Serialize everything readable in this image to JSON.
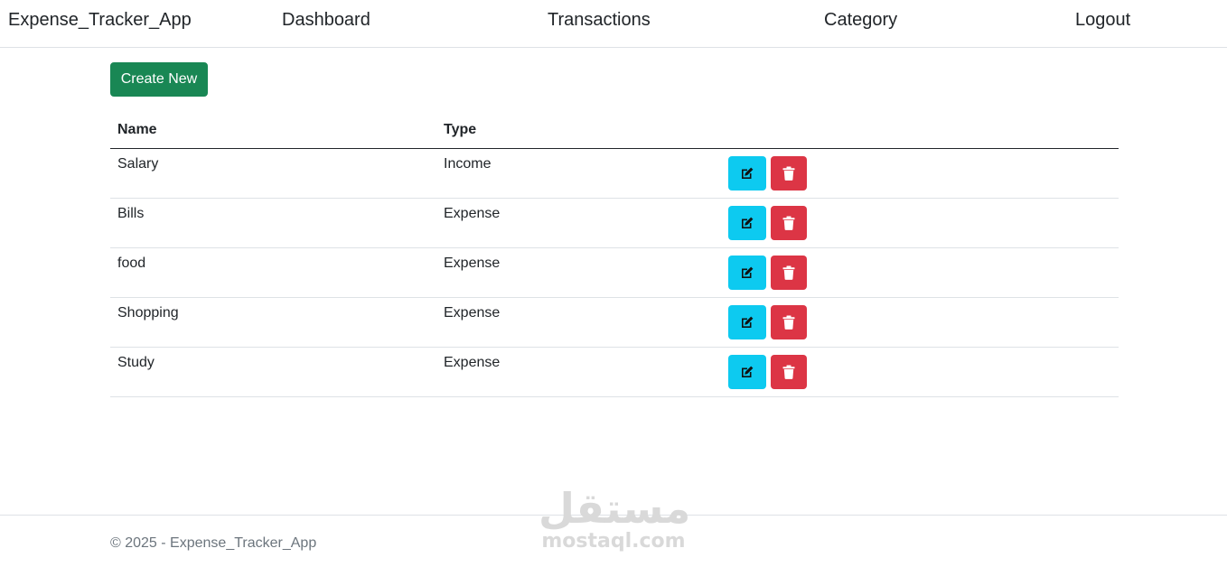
{
  "nav": {
    "brand": "Expense_Tracker_App",
    "links": [
      "Dashboard",
      "Transactions",
      "Category",
      "Logout"
    ]
  },
  "create_button": "Create New",
  "table": {
    "headers": [
      "Name",
      "Type",
      ""
    ],
    "rows": [
      {
        "name": "Salary",
        "type": "Income"
      },
      {
        "name": "Bills",
        "type": "Expense"
      },
      {
        "name": "food",
        "type": "Expense"
      },
      {
        "name": "Shopping",
        "type": "Expense"
      },
      {
        "name": "Study",
        "type": "Expense"
      }
    ],
    "row_actions": {
      "edit_icon": "edit-icon",
      "delete_icon": "trash-icon"
    }
  },
  "footer": {
    "text": "© 2025 - Expense_Tracker_App"
  },
  "watermark": {
    "arabic": "مستقل",
    "latin": "mostaql.com"
  },
  "colors": {
    "success": "#198754",
    "info": "#0dcaf0",
    "danger": "#dc3545",
    "muted": "#6c757d"
  }
}
